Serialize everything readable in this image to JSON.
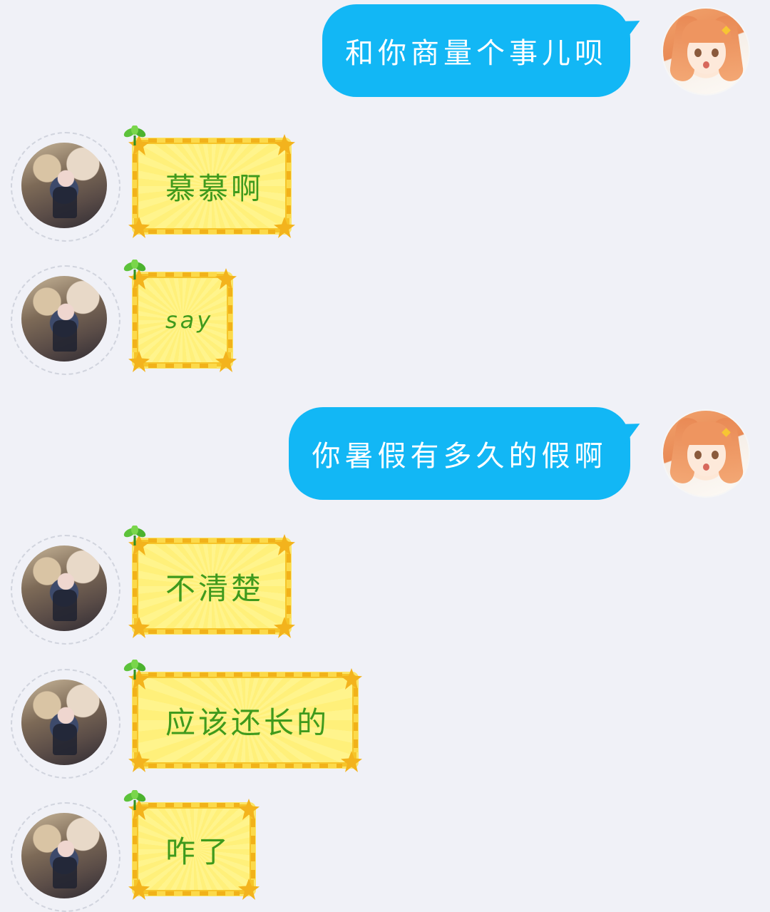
{
  "conversation": {
    "messages": [
      {
        "sender": "self",
        "text": "和你商量个事儿呗"
      },
      {
        "sender": "other",
        "text": "慕慕啊"
      },
      {
        "sender": "other",
        "text": "say"
      },
      {
        "sender": "self",
        "text": "你暑假有多久的假啊"
      },
      {
        "sender": "other",
        "text": "不清楚"
      },
      {
        "sender": "other",
        "text": "应该还长的"
      },
      {
        "sender": "other",
        "text": "咋了"
      }
    ]
  },
  "theme": {
    "background": "#f0f1f7",
    "self_bubble": "#12b7f5",
    "other_bubble_fill": "#fff48c",
    "other_bubble_border": "#f6c52a",
    "other_text": "#3f9a1d",
    "self_text": "#ffffff"
  }
}
